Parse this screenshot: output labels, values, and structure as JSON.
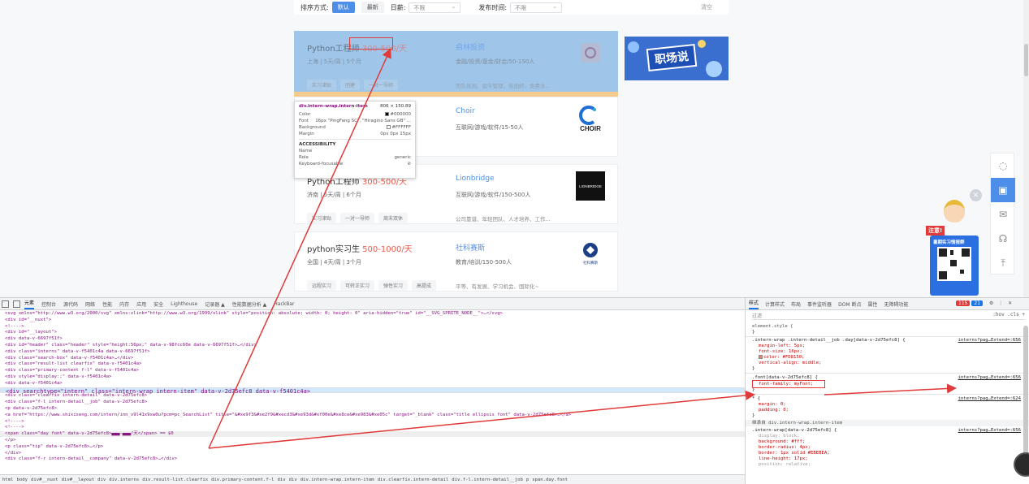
{
  "filter_bar": {
    "sort_label": "排序方式:",
    "sort_options": [
      "默认",
      "最新"
    ],
    "day_label": "日薪:",
    "day_value": "不限",
    "time_label": "发布时间:",
    "time_value": "不限",
    "clear": "清空"
  },
  "cards": [
    {
      "title": "Python工程师",
      "salary": "300-500/天",
      "meta": "上海 | 5天/周 | 5个月",
      "company": "启林投资",
      "ctype": "金融/投资/基金/财会/50-150人",
      "tags": [
        "实习津贴",
        "团建",
        "一对一导师"
      ],
      "perks": "团队氛围、扁平管理、氛围好、免费水..."
    },
    {
      "title": "",
      "salary": "",
      "meta": "",
      "company": "Choir",
      "ctype": "互联网/游戏/软件/15-50人",
      "tags": [],
      "perks": "",
      "logo": "CHOIR"
    },
    {
      "title": "Python工程师",
      "salary": "300-500/天",
      "meta": "济南 | 5天/周 | 6个月",
      "company": "Lionbridge",
      "ctype": "互联网/游戏/软件/150-500人",
      "tags": [
        "实习津贴",
        "一对一导师",
        "周末双休"
      ],
      "perks": "公司靠谱、年轻团队、人才培养、工作...",
      "logo": "LIONBRIDGE"
    },
    {
      "title": "python实习生",
      "salary": "500-1000/天",
      "meta": "全国 | 4天/周 | 3个月",
      "company": "社科赛斯",
      "ctype": "教育/培训/150-500人",
      "tags": [
        "远程实习",
        "可转正实习",
        "弹性实习",
        "高提成"
      ],
      "perks": "平等、有发展、学习机会、国际化~",
      "logo": "社科赛斯"
    }
  ],
  "banner": {
    "text": "职场说"
  },
  "mascot": {
    "note": "注意!",
    "board": "暑期实习情报群"
  },
  "tooltip": {
    "selector": "div.intern-wrap.intern-item",
    "size": "806 × 150.89",
    "rows": [
      {
        "k": "Color",
        "v": "#000000"
      },
      {
        "k": "Font",
        "v": "16px \"PingFang SC\", \"Hiragino Sans GB\" ..."
      },
      {
        "k": "Background",
        "v": "#FFFFFF"
      },
      {
        "k": "Margin",
        "v": "0px 0px 15px"
      }
    ],
    "section": "ACCESSIBILITY",
    "acc_rows": [
      {
        "k": "Name",
        "v": ""
      },
      {
        "k": "Role",
        "v": "generic"
      },
      {
        "k": "Keyboard-focusable",
        "v": "⊘"
      }
    ]
  },
  "devtools": {
    "tabs": [
      "元素",
      "控制台",
      "源代码",
      "网络",
      "性能",
      "内存",
      "应用",
      "安全",
      "Lighthouse",
      "记录器 ▲",
      "性能数据分析 ▲",
      "HackBar"
    ],
    "right_tabs": [
      "样式",
      "计算样式",
      "布局",
      "事件监听器",
      "DOM 断点",
      "属性",
      "无障碍功能"
    ],
    "errors": "115",
    "issues": "21",
    "element_lines": [
      "<svg xmlns=\"http://www.w3.org/2000/svg\" xmlns:xlink=\"http://www.w3.org/1999/xlink\" style=\"position: absolute; width: 0; height: 0\" aria-hidden=\"true\" id=\"__SVG_SPRITE_NODE__\">…</svg>",
      "<div id=\"__nuxt\">",
      "  <!---->",
      "  <div id=\"__layout\">",
      "    <div data-v-6697f51f>",
      "      <div id=\"header\" class=\"header\" style=\"height:56px;\" data-v-98fcc60e data-v-6697f51f>…</div>",
      "      <div class=\"interns\" data-v-f5401c4a data-v-6697f51f>",
      "        <div class=\"search-box\" data-v-f5401c4a>…</div>",
      "        <div class=\"result-list clearfix\" data-v-f5401c4a>",
      "          <div class=\"primary-content f-l\" data-v-f5401c4a>",
      "            <div style=\"display:;\" data-v-f5401c4a>",
      "              <div data-v-f5401c4a>",
      "                <div searchtype=\"intern\" class=\"intern-wrap intern-item\" data-v-2d75efc8 data-v-f5401c4a>",
      "                  <div class=\"clearfix intern-detail\" data-v-2d75efc8>",
      "                    <div class=\"f-l intern-detail__job\" data-v-2d75efc8>",
      "                      <p data-v-2d75efc8>",
      "                        <a href=\"https://www.shixiseng.com/intern/inn_v9l41x9xw0u?pcm=pc_SearchList\" title=\"&#xe9f3&#xe2f9&#xecd3&#xe93d&#xf00e&#xe8ce&#xe983&#xe05c\" target=\"_blank\" class=\"title ellipsis font\" data-v-2d75efc8>…</a>",
      "                        <!---->",
      "                        <!---->",
      "                        <span class=\"day font\" data-v-2d75efc8>▄▄▄-▄▄▄/天</span> == $0",
      "                      </p>",
      "                      <p class=\"tip\" data-v-2d75efc8>…</p>",
      "                    </div>",
      "                    <div class=\"f-r intern-detail__company\" data-v-2d75efc8>…</div>"
    ],
    "breadcrumbs": [
      "html",
      "body",
      "div#__nuxt",
      "div#__layout",
      "div",
      "div.interns",
      "div.result-list.clearfix",
      "div.primary-content.f-l",
      "div",
      "div",
      "div.intern-wrap.intern-item",
      "div.clearfix.intern-detail",
      "div.f-l.intern-detail__job",
      "p",
      "span.day.font"
    ],
    "styles": {
      "filter_placeholder": "过滤",
      "filter_right": ":hov  .cls  +",
      "element_style": "element.style {",
      "rule1_sel": ".intern-wrap .intern-detail__job .day[data-v-2d75efc8] {",
      "rule1_props": [
        "margin-left: 5px;",
        "font-size: 16px;",
        "color: #FD8150;",
        "vertical-align: middle;"
      ],
      "rule1_src": "interns?pag…Extend=:656",
      "rule2_sel": ".font[data-v-2d75efc8] {",
      "rule2_props": [
        "font-family: myFont;"
      ],
      "rule2_src": "interns?pag…Extend=:656",
      "rule3_sel": "* {",
      "rule3_props": [
        "margin: 0;",
        "padding: 0;"
      ],
      "rule3_src": "interns?pag…Extend=:624",
      "inherited": "继承自 div.intern-wrap.intern-item",
      "rule4_sel": ".intern-wrap[data-v-2d75efc8] {",
      "rule4_props": [
        "display: block;",
        "background: #fff;",
        "border-radius: 4px;",
        "border: 1px solid #EBEBEA;",
        "line-height: 17px;",
        "position: relative;"
      ],
      "rule4_src": "interns?pag…Extend=:656",
      "close": "}"
    }
  },
  "colors": {
    "accent": "#4d8fe8",
    "salary": "#f05a4b",
    "highlight": "#9fc5e8",
    "arrow": "#e03a3a"
  }
}
